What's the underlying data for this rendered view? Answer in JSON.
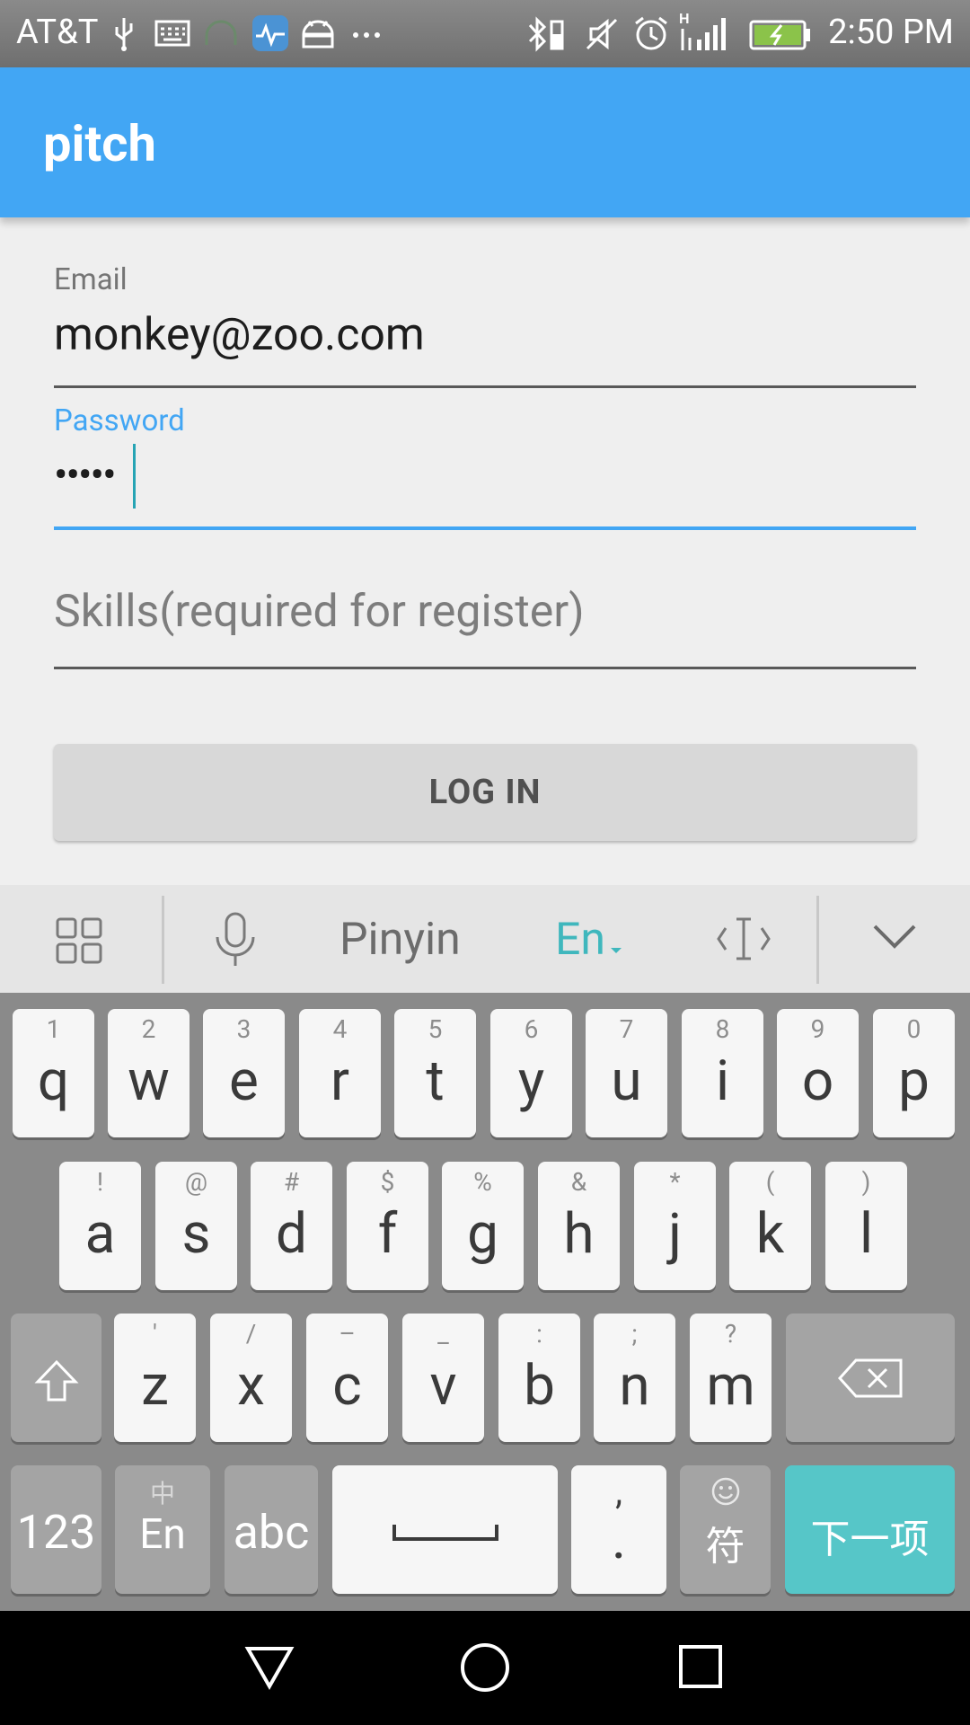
{
  "status_bar": {
    "carrier": "AT&T",
    "time": "2:50 PM",
    "icons": [
      "usb-icon",
      "keyboard-icon",
      "headset-icon",
      "health-app-icon",
      "android-icon",
      "more-notifications-icon",
      "bluetooth-icon",
      "mute-icon",
      "alarm-icon",
      "signal-icon",
      "battery-icon"
    ]
  },
  "app_bar": {
    "title": "pitch",
    "color": "#42a6f4"
  },
  "form": {
    "email": {
      "label": "Email",
      "value": "monkey@zoo.com"
    },
    "password": {
      "label": "Password",
      "value": "•••••"
    },
    "skills": {
      "placeholder": "Skills(required for register)"
    },
    "login_button": "LOG IN"
  },
  "keyboard": {
    "toolbar": {
      "pinyin": "Pinyin",
      "en": "En",
      "icons": [
        "grid-icon",
        "microphone-icon",
        "cursor-icon",
        "collapse-keyboard-icon"
      ]
    },
    "rows": [
      [
        {
          "key": "q",
          "sub": "1"
        },
        {
          "key": "w",
          "sub": "2"
        },
        {
          "key": "e",
          "sub": "3"
        },
        {
          "key": "r",
          "sub": "4"
        },
        {
          "key": "t",
          "sub": "5"
        },
        {
          "key": "y",
          "sub": "6"
        },
        {
          "key": "u",
          "sub": "7"
        },
        {
          "key": "i",
          "sub": "8"
        },
        {
          "key": "o",
          "sub": "9"
        },
        {
          "key": "p",
          "sub": "0"
        }
      ],
      [
        {
          "key": "a",
          "sub": "!"
        },
        {
          "key": "s",
          "sub": "@"
        },
        {
          "key": "d",
          "sub": "#"
        },
        {
          "key": "f",
          "sub": "$"
        },
        {
          "key": "g",
          "sub": "%"
        },
        {
          "key": "h",
          "sub": "&"
        },
        {
          "key": "j",
          "sub": "*"
        },
        {
          "key": "k",
          "sub": "("
        },
        {
          "key": "l",
          "sub": ")"
        }
      ],
      [
        {
          "key": "z",
          "sub": "'"
        },
        {
          "key": "x",
          "sub": "/"
        },
        {
          "key": "c",
          "sub": "–"
        },
        {
          "key": "v",
          "sub": "_"
        },
        {
          "key": "b",
          "sub": ":"
        },
        {
          "key": "n",
          "sub": ";"
        },
        {
          "key": "m",
          "sub": "?"
        }
      ]
    ],
    "bottom": {
      "num": "123",
      "lang_main": "En",
      "lang_sub": "中",
      "abc": "abc",
      "period": ".",
      "period_sub": ",",
      "symbol": "符",
      "next": "下一项"
    },
    "accent": "#56c6c8"
  },
  "nav_bar": {
    "icons": [
      "back-icon",
      "home-icon",
      "recents-icon"
    ]
  }
}
